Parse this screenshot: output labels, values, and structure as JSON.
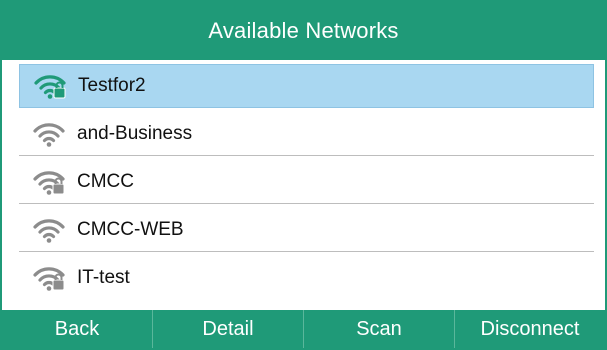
{
  "title": "Available Networks",
  "colors": {
    "brand": "#1f9a78",
    "selection": "#a9d7f1",
    "wifi_connected": "#1f9a78",
    "wifi_idle": "#8c8c8c"
  },
  "networks": [
    {
      "name": "Testfor2",
      "secured": true,
      "connected": true,
      "selected": true,
      "icon": "wifi-locked-icon"
    },
    {
      "name": "and-Business",
      "secured": false,
      "connected": false,
      "selected": false,
      "icon": "wifi-icon"
    },
    {
      "name": "CMCC",
      "secured": true,
      "connected": false,
      "selected": false,
      "icon": "wifi-locked-icon"
    },
    {
      "name": "CMCC-WEB",
      "secured": false,
      "connected": false,
      "selected": false,
      "icon": "wifi-icon"
    },
    {
      "name": "IT-test",
      "secured": true,
      "connected": false,
      "selected": false,
      "icon": "wifi-locked-icon"
    }
  ],
  "softkeys": [
    "Back",
    "Detail",
    "Scan",
    "Disconnect"
  ]
}
